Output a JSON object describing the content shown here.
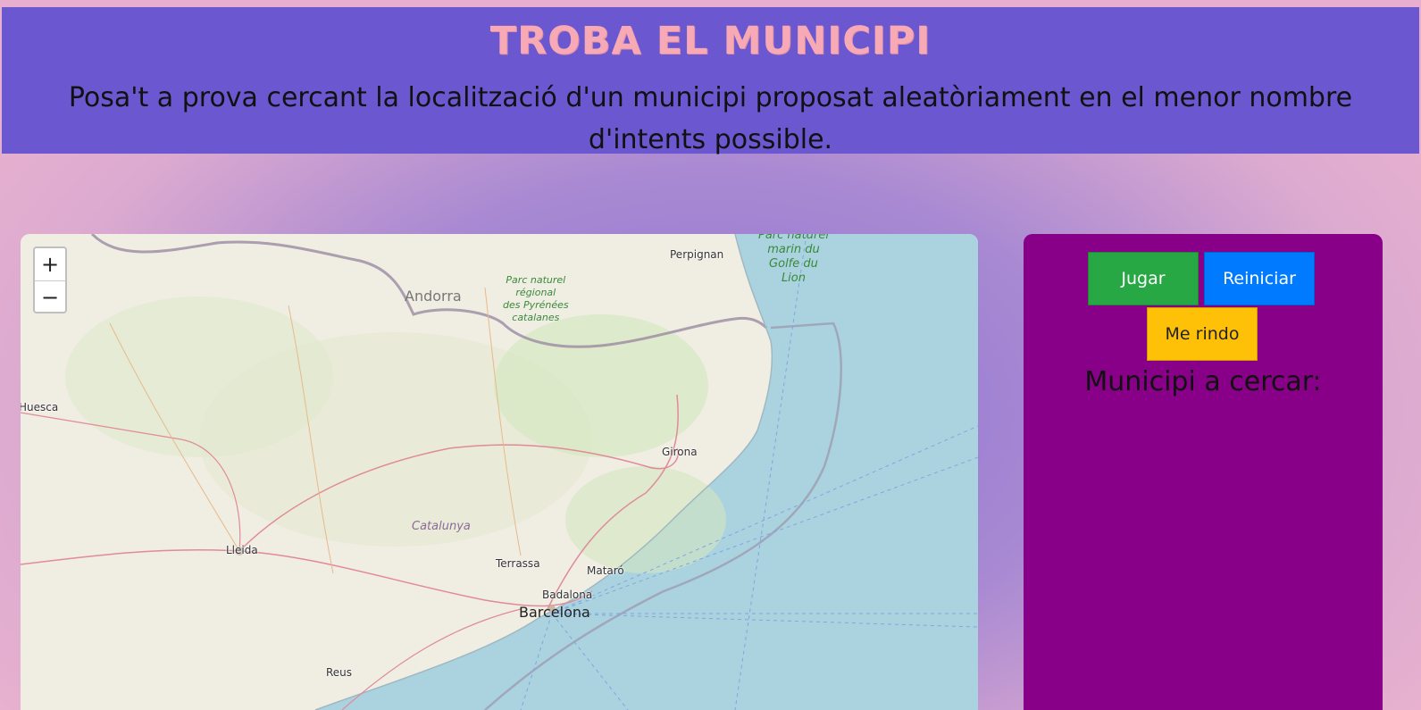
{
  "header": {
    "title": "TROBA EL MUNICIPI",
    "description": "Posa't a prova cercant la localització d'un municipi proposat aleatòriament en el menor nombre d'intents possible."
  },
  "map": {
    "zoom_in": "+",
    "zoom_out": "−",
    "labels": {
      "perpignan": "Perpignan",
      "andorra": "Andorra",
      "huesca": "Huesca",
      "girona": "Girona",
      "lleida": "Lleida",
      "catalunya": "Catalunya",
      "terrassa": "Terrassa",
      "mataro": "Mataró",
      "badalona": "Badalona",
      "barcelona": "Barcelona",
      "reus": "Reus",
      "park_pyrenees": "Parc naturel\nrégional\ndes Pyrénées\ncatalanes",
      "park_golfe": "Parc naturel\nmarin du\nGolfe du\nLion"
    }
  },
  "panel": {
    "play_label": "Jugar",
    "restart_label": "Reiniciar",
    "give_up_label": "Me rindo",
    "target_label": "Municipi a cercar:"
  },
  "colors": {
    "header_bg": "#6b58d0",
    "title": "#f7a9b6",
    "panel_bg": "#880088",
    "play": "#28a745",
    "restart": "#007bff",
    "give_up": "#ffc107",
    "sea": "#aad3df"
  }
}
